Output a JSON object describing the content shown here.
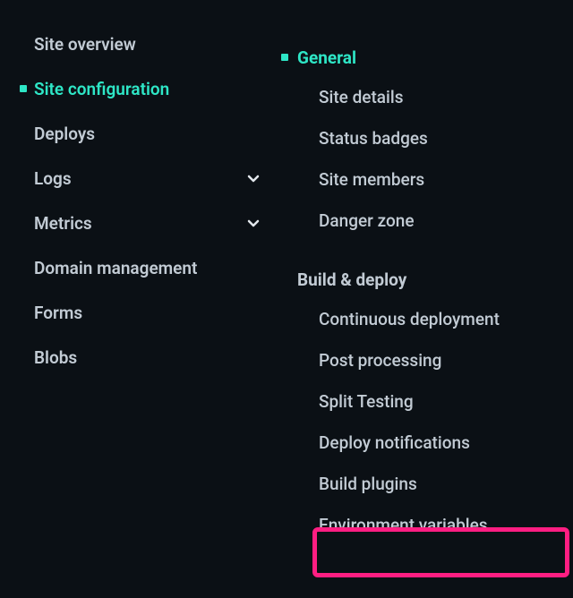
{
  "left_nav": {
    "items": [
      {
        "label": "Site overview",
        "active": false,
        "chevron": false,
        "name": "nav-site-overview"
      },
      {
        "label": "Site configuration",
        "active": true,
        "chevron": false,
        "name": "nav-site-configuration"
      },
      {
        "label": "Deploys",
        "active": false,
        "chevron": false,
        "name": "nav-deploys"
      },
      {
        "label": "Logs",
        "active": false,
        "chevron": true,
        "name": "nav-logs"
      },
      {
        "label": "Metrics",
        "active": false,
        "chevron": true,
        "name": "nav-metrics"
      },
      {
        "label": "Domain management",
        "active": false,
        "chevron": false,
        "name": "nav-domain-management"
      },
      {
        "label": "Forms",
        "active": false,
        "chevron": false,
        "name": "nav-forms"
      },
      {
        "label": "Blobs",
        "active": false,
        "chevron": false,
        "name": "nav-blobs"
      }
    ]
  },
  "right_nav": {
    "sections": [
      {
        "label": "General",
        "active": true,
        "name": "section-general",
        "items": [
          {
            "label": "Site details",
            "name": "sub-site-details"
          },
          {
            "label": "Status badges",
            "name": "sub-status-badges"
          },
          {
            "label": "Site members",
            "name": "sub-site-members"
          },
          {
            "label": "Danger zone",
            "name": "sub-danger-zone"
          }
        ]
      },
      {
        "label": "Build & deploy",
        "active": false,
        "name": "section-build-deploy",
        "items": [
          {
            "label": "Continuous deployment",
            "name": "sub-continuous-deployment"
          },
          {
            "label": "Post processing",
            "name": "sub-post-processing"
          },
          {
            "label": "Split Testing",
            "name": "sub-split-testing"
          },
          {
            "label": "Deploy notifications",
            "name": "sub-deploy-notifications"
          },
          {
            "label": "Build plugins",
            "name": "sub-build-plugins"
          },
          {
            "label": "Environment variables",
            "name": "sub-environment-variables"
          }
        ]
      }
    ]
  },
  "highlight": {
    "target": "sub-environment-variables",
    "color": "#ff1e82"
  }
}
